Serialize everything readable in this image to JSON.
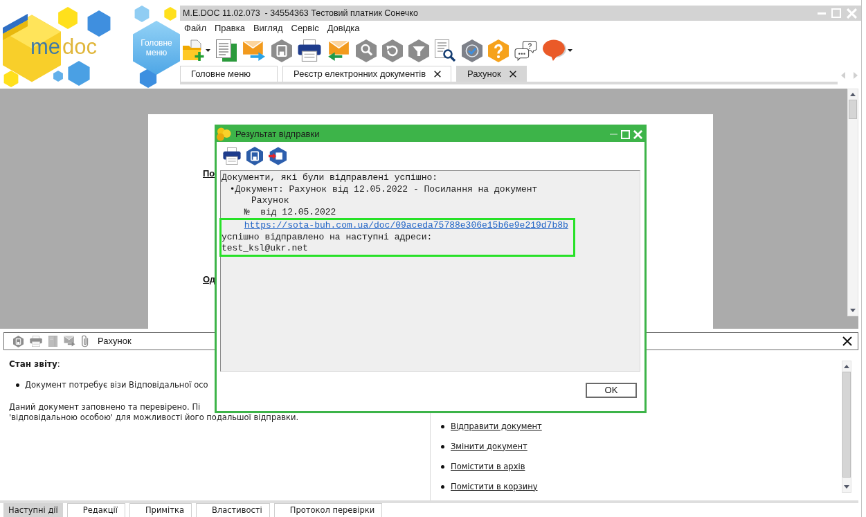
{
  "window": {
    "title": "M.E.DOC 11.02.073  - 34554363 Тестовий платник Сонечко"
  },
  "logo": {
    "part_1": "me",
    "part_2": "doc"
  },
  "main_menu_button": {
    "label": "Головне меню"
  },
  "menu": [
    "Файл",
    "Правка",
    "Вигляд",
    "Сервіс",
    "Довідка"
  ],
  "tabs": [
    {
      "label": "Головне меню",
      "selected": false,
      "closable": false
    },
    {
      "label": "Реєстр електронних документів",
      "selected": false,
      "closable": true
    },
    {
      "label": "Рахунок",
      "selected": true,
      "closable": true
    }
  ],
  "document": {
    "links": [
      "По",
      "Од"
    ]
  },
  "dialog": {
    "title": "Результат відправки",
    "lines": [
      {
        "kind": "heading",
        "text": "Документи, які були відправлені успішно:",
        "highlighted": false
      },
      {
        "kind": "item",
        "text": "•Документ: Рахунок від 12.05.2022 - Посилання на документ",
        "highlighted": false
      },
      {
        "kind": "continuation",
        "text": "Рахунок",
        "highlighted": false
      },
      {
        "kind": "detail",
        "text": "№  від 12.05.2022",
        "highlighted": false
      },
      {
        "kind": "link",
        "text": "https://sota-buh.com.ua/doc/09aceda75788e306e15b6e9e219d7b8b",
        "highlighted": true
      },
      {
        "kind": "plain",
        "text": "успішно відправлено на наступні адреси:",
        "highlighted": true
      },
      {
        "kind": "plain",
        "text": "test_ksl@ukr.net",
        "highlighted": true
      }
    ],
    "ok_button": "OK"
  },
  "panel": {
    "title": "Рахунок",
    "status_heading": "**Стан звіту**:",
    "status_items": [
      "Документ потребує візи Відповідальної осо"
    ],
    "note_lines": [
      "Даний документ заповнено та перевірено. Пі",
      "'відповідальною особою' для можливості його подальшої відправки."
    ],
    "actions": [
      "Відправити документ",
      "Змінити документ",
      "Помістити в архів",
      "Помістити в корзину"
    ]
  },
  "bottom_tabs": [
    {
      "label": "Наступні дії",
      "selected": true
    },
    {
      "label": "Редакції",
      "selected": false
    },
    {
      "label": "Примітка",
      "selected": false
    },
    {
      "label": "Властивості",
      "selected": false
    },
    {
      "label": "Протокол перевірки",
      "selected": false
    }
  ]
}
